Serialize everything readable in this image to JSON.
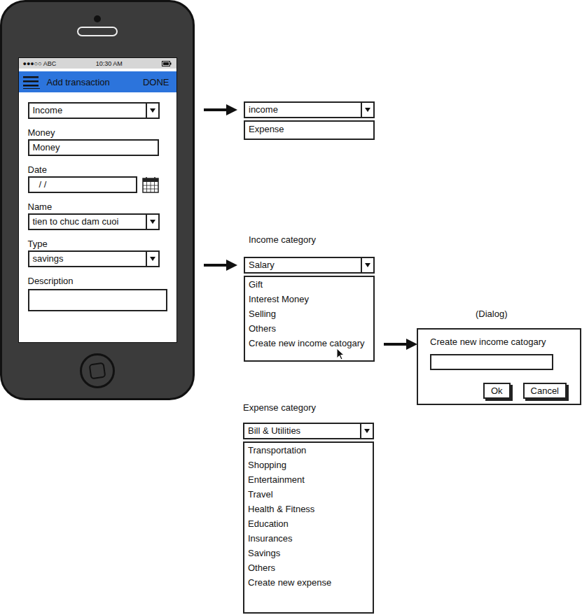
{
  "phone": {
    "status_bar": {
      "carrier": "●●●○○ ABC",
      "time": "10:30 AM"
    },
    "app_bar": {
      "title": "Add transaction",
      "action": "DONE"
    },
    "fields": [
      {
        "kind": "select",
        "value": "Income"
      },
      {
        "kind": "input",
        "label": "Money",
        "value": "Money"
      },
      {
        "kind": "date",
        "label": "Date",
        "value": "/ /"
      },
      {
        "kind": "select",
        "label": "Name",
        "value": "tien to chuc dam cuoi"
      },
      {
        "kind": "select",
        "label": "Type",
        "value": "savings"
      },
      {
        "kind": "textarea",
        "label": "Description",
        "value": ""
      }
    ]
  },
  "type_dropdown": {
    "value": "income",
    "options": [
      "Expense"
    ]
  },
  "income_category": {
    "title": "Income category",
    "value": "Salary",
    "options": [
      {
        "label": "Gift",
        "pointed": false
      },
      {
        "label": "Interest Money",
        "pointed": false
      },
      {
        "label": "Selling",
        "pointed": false
      },
      {
        "label": "Others",
        "pointed": false
      },
      {
        "label": "Create new income catogary",
        "pointed": true
      }
    ]
  },
  "dialog": {
    "caption": "(Dialog)",
    "title": "Create new income catogary",
    "input": "",
    "buttons": [
      "Ok",
      "Cancel"
    ]
  },
  "expense_category": {
    "title": "Expense category",
    "value": "Bill & Utilities",
    "options": [
      "Transportation",
      "Shopping",
      "Entertainment",
      "Travel",
      "Health & Fitness",
      "Education",
      "Insurances",
      "Savings",
      "Others",
      "Create new expense"
    ]
  }
}
